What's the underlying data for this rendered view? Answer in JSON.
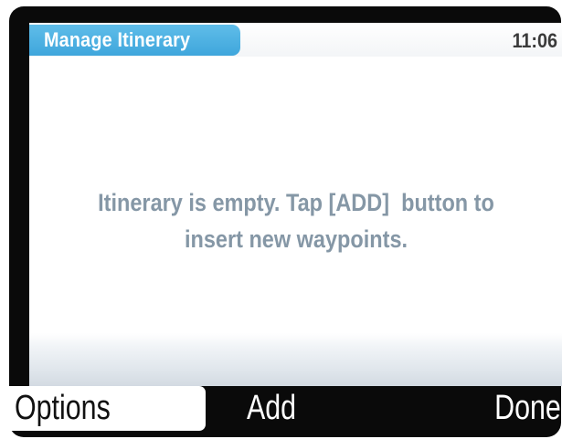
{
  "header": {
    "title": "Manage Itinerary",
    "clock": "11:06"
  },
  "main": {
    "empty_message_line1": "Itinerary is empty. Tap [ADD]  button to",
    "empty_message_line2": "insert new waypoints."
  },
  "softkeys": {
    "left": "Options",
    "center": "Add",
    "right": "Done"
  },
  "colors": {
    "title_tab": "#46aadf",
    "message_text": "#8597a6",
    "device_frame": "#0a0a0a"
  }
}
